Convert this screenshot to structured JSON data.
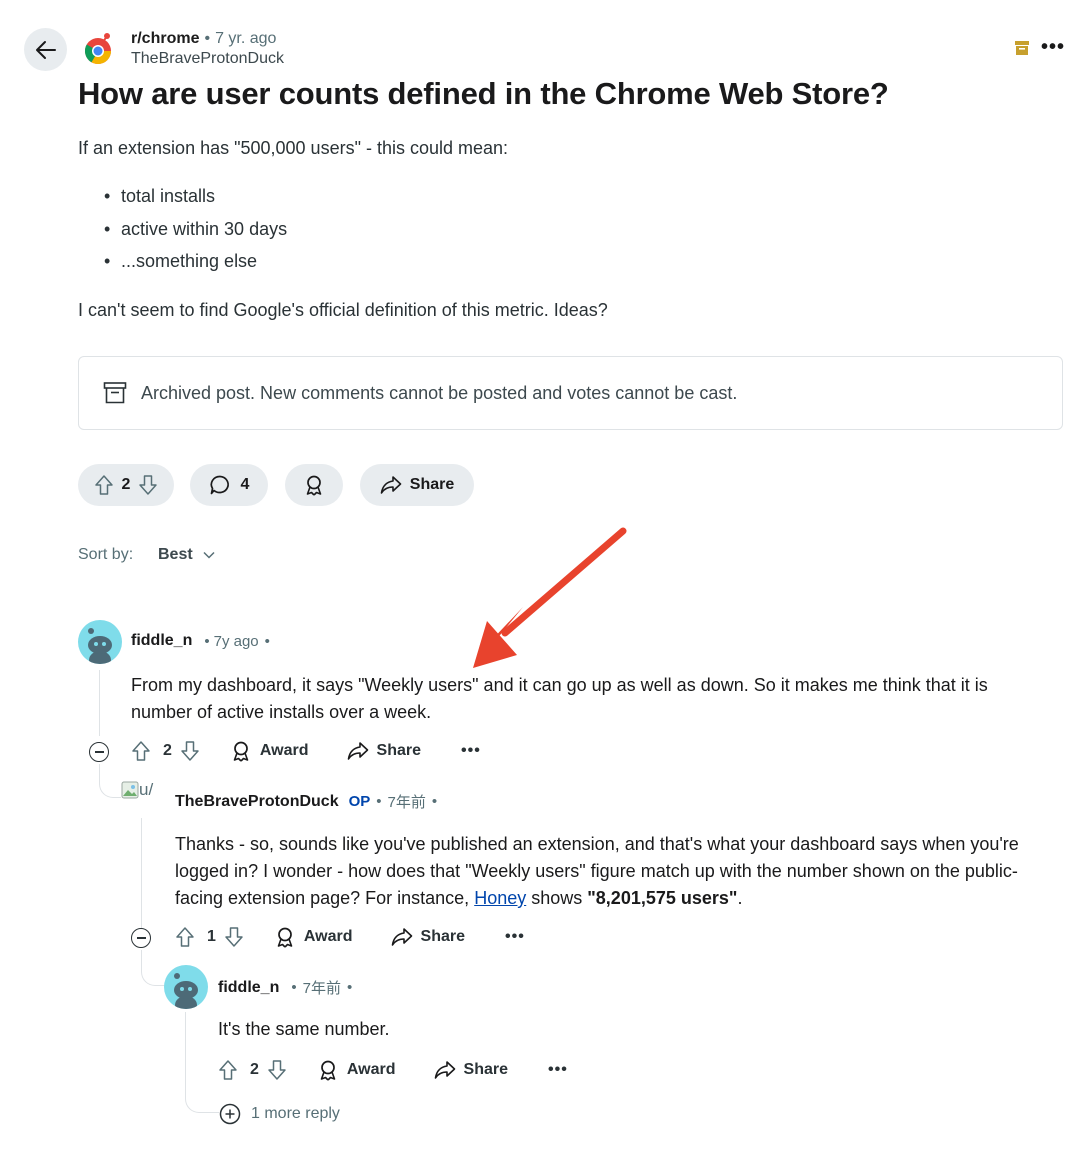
{
  "post": {
    "subreddit": "r/chrome",
    "age": "7 yr. ago",
    "author": "TheBraveProtonDuck",
    "title": "How are user counts defined in the Chrome Web Store?",
    "body_intro": "If an extension has \"500,000 users\" - this could mean:",
    "bullets": [
      "total installs",
      "active within 30 days",
      "...something else"
    ],
    "body_outro": "I can't seem to find Google's official definition of this metric. Ideas?",
    "archived_notice": "Archived post. New comments cannot be posted and votes cannot be cast.",
    "votes": "2",
    "comments": "4",
    "share_label": "Share"
  },
  "sort": {
    "label": "Sort by:",
    "value": "Best"
  },
  "comments": [
    {
      "author": "fiddle_n",
      "age": "7y ago",
      "text": "From my dashboard, it says \"Weekly users\" and it can go up as well as down. So it makes me think that it is number of active installs over a week.",
      "votes": "2",
      "award_label": "Award",
      "share_label": "Share"
    },
    {
      "author": "TheBraveProtonDuck",
      "op_badge": "OP",
      "age": "7年前",
      "avatar_alt": "u/",
      "text_before": "Thanks - so, sounds like you've published an extension, and that's what your dashboard says when you're logged in? I wonder - how does that \"Weekly users\" figure match up with the number shown on the public-facing extension page? For instance, ",
      "link_text": "Honey",
      "text_middle": " shows ",
      "text_bold": "\"8,201,575 users\"",
      "text_end": ".",
      "votes": "1",
      "award_label": "Award",
      "share_label": "Share"
    },
    {
      "author": "fiddle_n",
      "age": "7年前",
      "text": "It's the same number.",
      "votes": "2",
      "award_label": "Award",
      "share_label": "Share"
    }
  ],
  "more_replies": "1 more reply",
  "icons": {
    "back": "arrow-left-icon",
    "archive": "archive-icon",
    "upvote": "upvote-icon",
    "downvote": "downvote-icon",
    "comment": "comment-bubble-icon",
    "award": "award-icon",
    "share": "share-icon",
    "more": "more-dots-icon"
  },
  "colors": {
    "annotation_arrow": "#e8432d",
    "op_badge": "#0045ac",
    "archive_badge": "#c7a02e"
  }
}
